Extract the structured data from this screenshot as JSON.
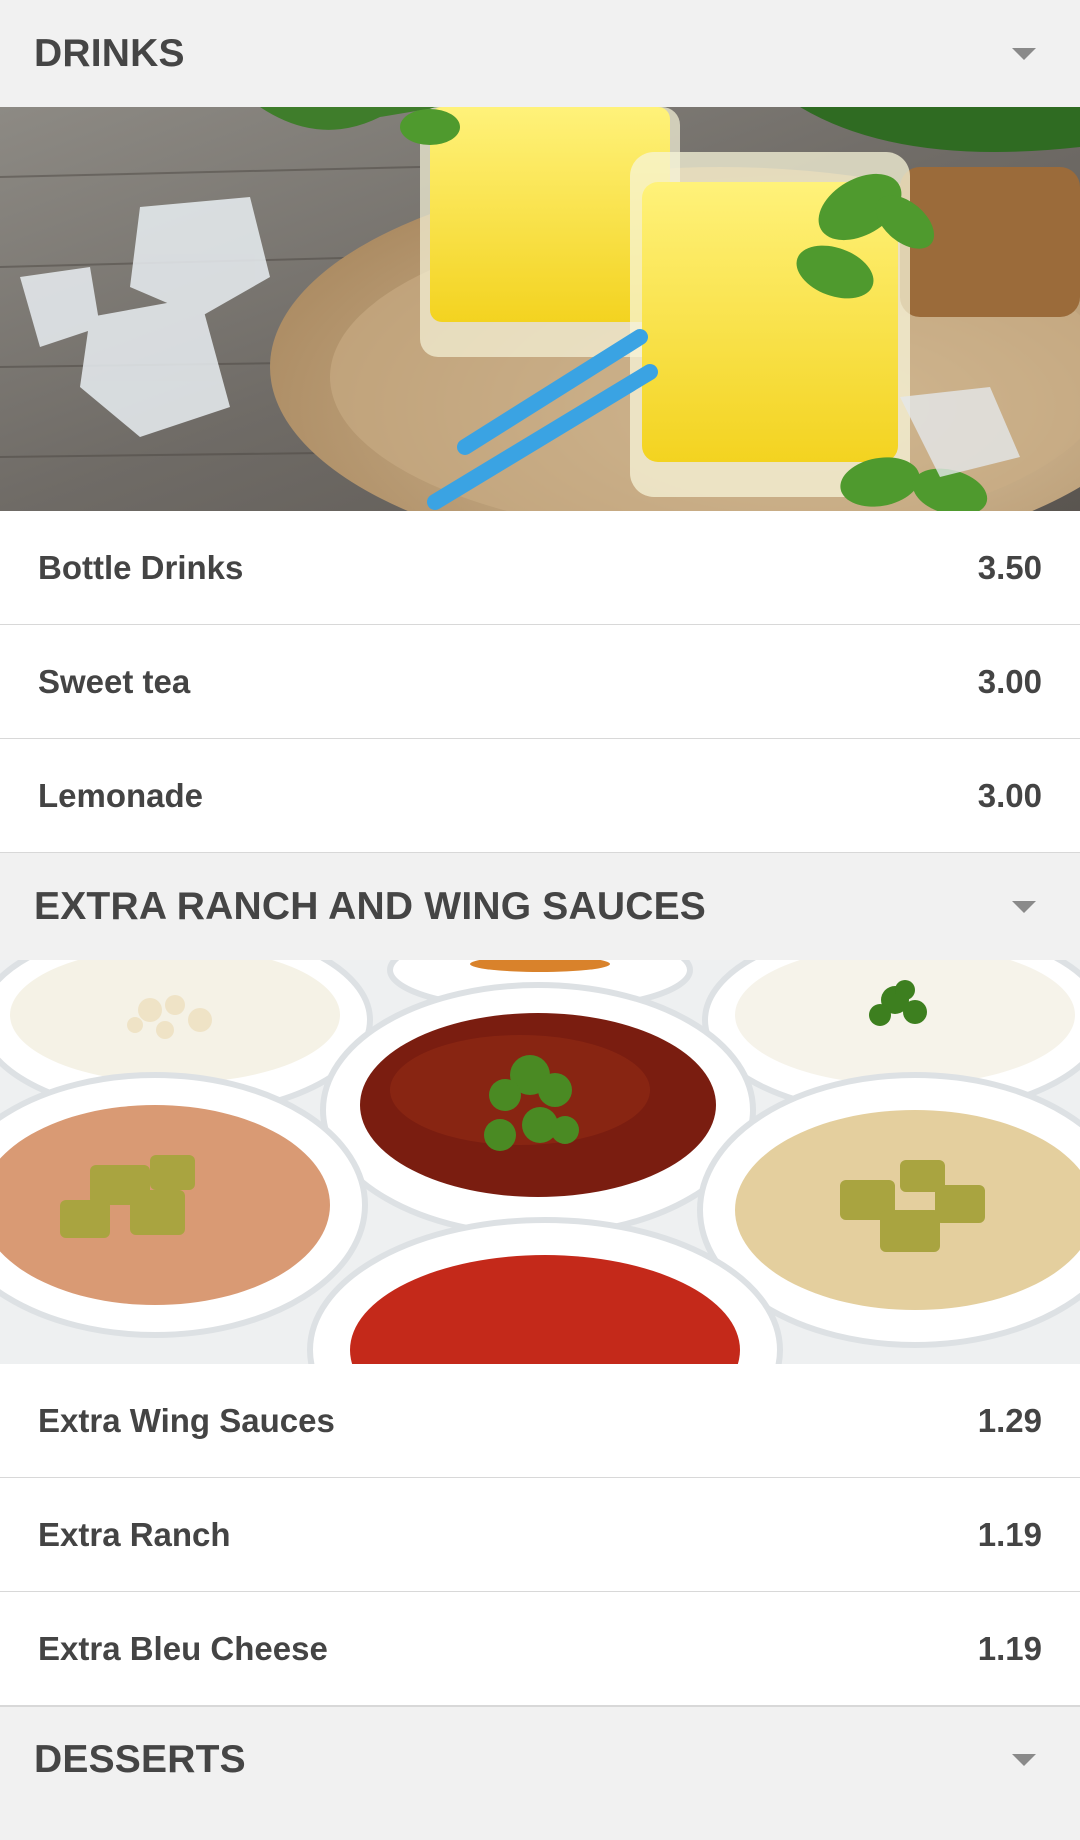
{
  "sections": [
    {
      "title": "DRINKS",
      "icon": "chevron-down-icon",
      "image": "drinks-photo",
      "items": [
        {
          "name": "Bottle Drinks",
          "price": "3.50"
        },
        {
          "name": "Sweet tea",
          "price": "3.00"
        },
        {
          "name": "Lemonade",
          "price": "3.00"
        }
      ]
    },
    {
      "title": "EXTRA RANCH AND WING SAUCES",
      "icon": "chevron-down-icon",
      "image": "sauces-photo",
      "items": [
        {
          "name": "Extra Wing Sauces",
          "price": "1.29"
        },
        {
          "name": "Extra Ranch",
          "price": "1.19"
        },
        {
          "name": "Extra Bleu Cheese",
          "price": "1.19"
        }
      ]
    },
    {
      "title": "DESSERTS",
      "icon": "chevron-down-icon"
    }
  ],
  "colors": {
    "header_bg": "#f1f1f1",
    "item_bg": "#ffffff",
    "text": "#444444",
    "divider": "#d8d8d8"
  }
}
